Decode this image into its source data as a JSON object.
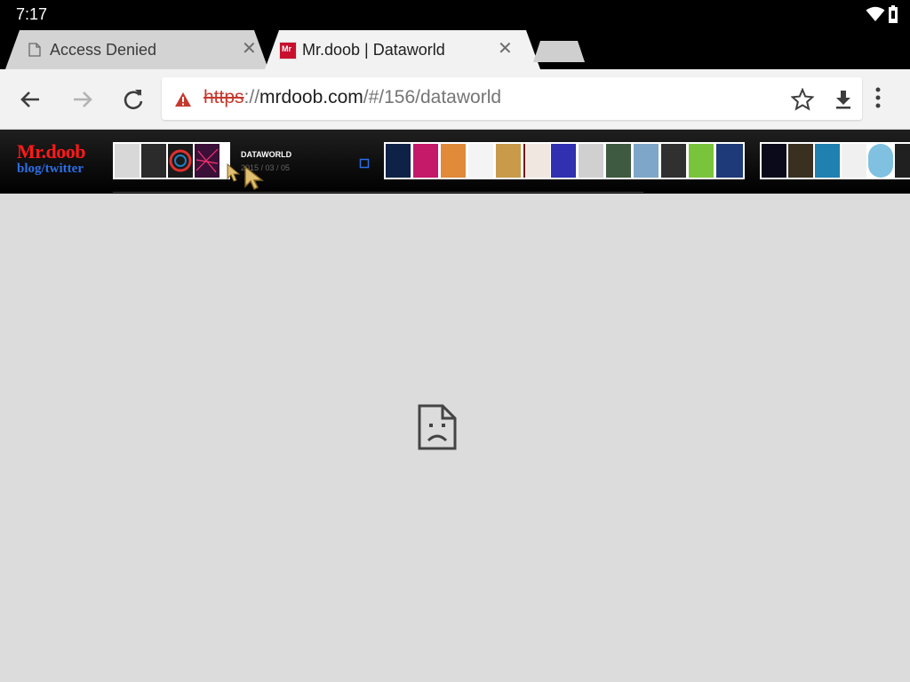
{
  "status": {
    "time": "7:17"
  },
  "tabs": [
    {
      "title": "Access Denied",
      "active": false,
      "close": "✕"
    },
    {
      "title": "Mr.doob | Dataworld",
      "active": true,
      "close": "✕",
      "favicon_text": "Mr"
    }
  ],
  "toolbar": {
    "url_scheme": "https",
    "url_sep": "://",
    "url_host": "mrdoob.com",
    "url_path": "/#/156/dataworld",
    "security": "insecure"
  },
  "page": {
    "logo_title": "Mr.doob",
    "logo_sub": "blog/twitter",
    "selected_title": "DATAWORLD",
    "selected_date": "2015 / 03 / 05",
    "thumbnail_colors_1": [
      "#d8d8d8",
      "#2b2b2b",
      "#1a1a1a",
      "#3b1038"
    ],
    "thumbnail_colors_2": [
      "#0d2246",
      "#c5196a",
      "#e08a3a",
      "#f4f4f4",
      "#c89a4a",
      "#6b1a1a",
      "#3030b0",
      "#d0d0d0",
      "#3e5a40",
      "#7ea6c8",
      "#303030",
      "#7ac43c",
      "#1e3a78"
    ],
    "thumbnail_colors_3": [
      "#0a0a1a",
      "#3a3020",
      "#2080b0",
      "#f0f0f0",
      "#80c0e0",
      "#202020"
    ]
  },
  "colors": {
    "error_bg": "#dcdcdc",
    "logo_red": "#ff1a1a",
    "logo_blue": "#2a6fe8"
  }
}
